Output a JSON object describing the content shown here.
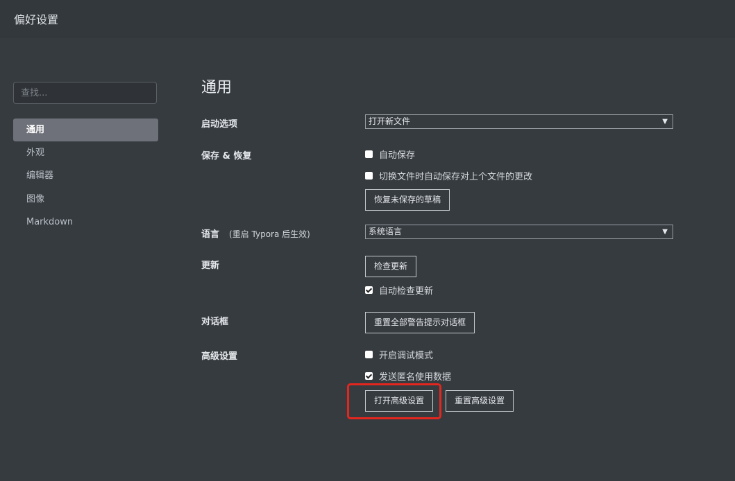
{
  "window": {
    "title": "偏好设置"
  },
  "sidebar": {
    "search_placeholder": "查找...",
    "items": [
      {
        "label": "通用",
        "active": true
      },
      {
        "label": "外观"
      },
      {
        "label": "编辑器"
      },
      {
        "label": "图像"
      },
      {
        "label": "Markdown"
      }
    ]
  },
  "main": {
    "title": "通用",
    "startup": {
      "label": "启动选项",
      "value": "打开新文件"
    },
    "save": {
      "label": "保存 & 恢复",
      "autosave": {
        "label": "自动保存",
        "checked": false
      },
      "autosave_on_switch": {
        "label": "切换文件时自动保存对上个文件的更改",
        "checked": false
      },
      "recover_button": "恢复未保存的草稿"
    },
    "language": {
      "label": "语言",
      "note": "(重启 Typora 后生效)",
      "value": "系统语言"
    },
    "update": {
      "label": "更新",
      "check_button": "检查更新",
      "auto_check": {
        "label": "自动检查更新",
        "checked": true
      }
    },
    "dialog": {
      "label": "对话框",
      "reset_button": "重置全部警告提示对话框"
    },
    "advanced": {
      "label": "高级设置",
      "debug": {
        "label": "开启调试模式",
        "checked": false
      },
      "anonymous_data": {
        "label": "发送匿名使用数据",
        "checked": true
      },
      "open_button": "打开高级设置",
      "reset_button": "重置高级设置"
    }
  },
  "colors": {
    "background": "#363b40",
    "active_item": "#6f717a",
    "highlight": "#e4261f"
  }
}
